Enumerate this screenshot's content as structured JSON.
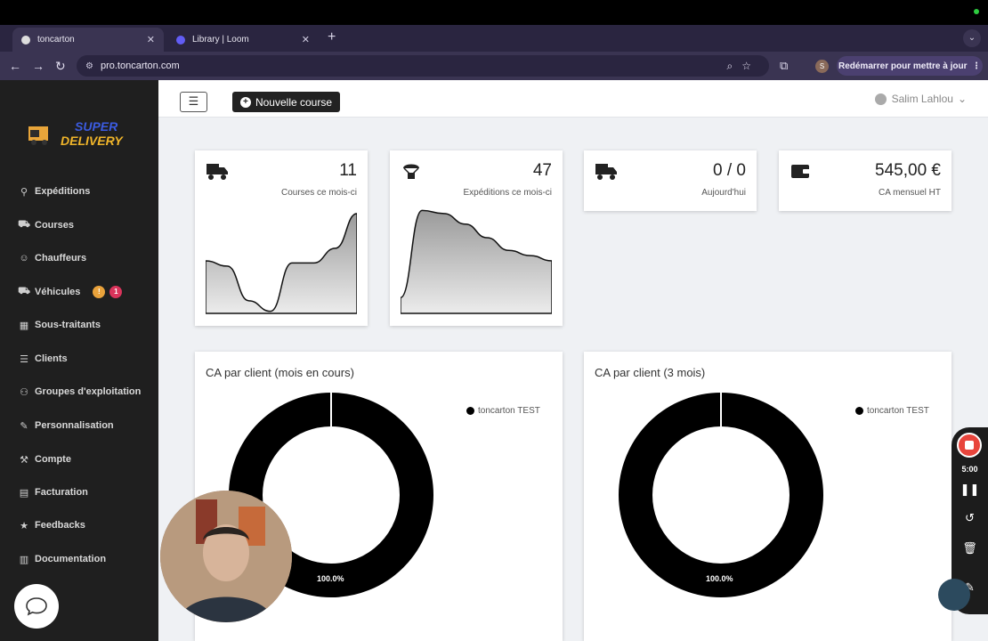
{
  "browser": {
    "tabs": [
      {
        "title": "toncarton",
        "active": true
      },
      {
        "title": "Library | Loom",
        "active": false
      }
    ],
    "url": "pro.toncarton.com",
    "profile_initial": "S",
    "relaunch_label": "Redémarrer pour mettre à jour"
  },
  "sidebar": {
    "items": [
      {
        "label": "Expéditions",
        "icon": "shipment-icon"
      },
      {
        "label": "Courses",
        "icon": "dolly-icon"
      },
      {
        "label": "Chauffeurs",
        "icon": "users-icon"
      },
      {
        "label": "Véhicules",
        "icon": "truck-icon"
      },
      {
        "label": "Sous-traitants",
        "icon": "building-icon"
      },
      {
        "label": "Clients",
        "icon": "list-icon"
      },
      {
        "label": "Groupes d'exploitation",
        "icon": "people-carry-icon"
      },
      {
        "label": "Personnalisation",
        "icon": "tools-icon"
      },
      {
        "label": "Compte",
        "icon": "wrench-icon"
      },
      {
        "label": "Facturation",
        "icon": "invoice-icon"
      },
      {
        "label": "Feedbacks",
        "icon": "star-icon"
      },
      {
        "label": "Documentation",
        "icon": "book-icon"
      }
    ],
    "vehicle_badges": [
      "!",
      "1"
    ],
    "badge_colors": [
      "#e9a23b",
      "#d9345b"
    ]
  },
  "header": {
    "new_course_label": "Nouvelle course",
    "user_name": "Salim Lahlou"
  },
  "stats": [
    {
      "value": "11",
      "label": "Courses ce mois-ci",
      "icon": "truck-icon"
    },
    {
      "value": "47",
      "label": "Expéditions ce mois-ci",
      "icon": "parachute-box-icon"
    },
    {
      "value": "0 / 0",
      "label": "Aujourd'hui",
      "icon": "truck-icon"
    },
    {
      "value": "545,00 €",
      "label": "CA mensuel HT",
      "icon": "wallet-icon"
    }
  ],
  "chart_data": [
    {
      "type": "area",
      "series": [
        {
          "values": [
            0.5,
            0.45,
            0.12,
            0.02,
            0.48,
            0.48,
            0.62,
            0.95
          ]
        }
      ]
    },
    {
      "type": "area",
      "series": [
        {
          "values": [
            0.15,
            0.98,
            0.95,
            0.85,
            0.72,
            0.6,
            0.55,
            0.5
          ]
        }
      ]
    },
    {
      "type": "pie",
      "title": "CA par client (mois en cours)",
      "categories": [
        "toncarton TEST"
      ],
      "values": [
        100.0
      ],
      "data_labels": [
        "100.0%"
      ],
      "legend": "top-right"
    },
    {
      "type": "pie",
      "title": "CA par client (3 mois)",
      "categories": [
        "toncarton TEST"
      ],
      "values": [
        100.0
      ],
      "data_labels": [
        "100.0%"
      ],
      "legend": "top-right"
    }
  ],
  "loom": {
    "timer": "5:00"
  },
  "colors": {
    "sidebar_bg": "#1f1f1f",
    "main_bg": "#eff1f4",
    "accent": "#222222"
  }
}
